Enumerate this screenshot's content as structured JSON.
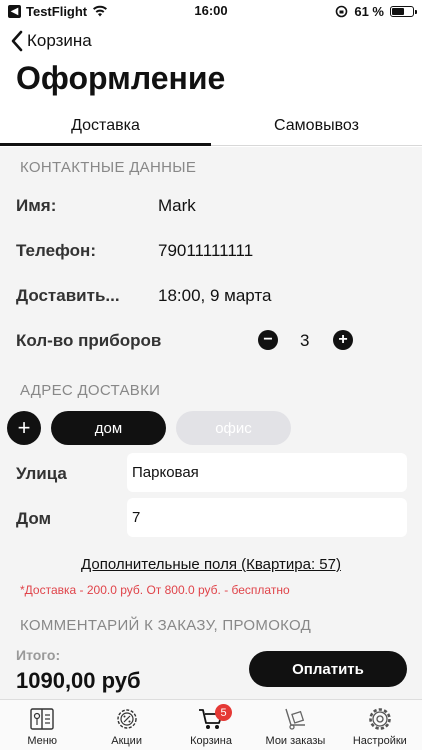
{
  "status_bar": {
    "carrier": "TestFlight",
    "time": "16:00",
    "battery": "61 %",
    "battery_level": 0.61
  },
  "nav": {
    "back_label": "Корзина",
    "title": "Оформление"
  },
  "tabs": [
    {
      "label": "Доставка",
      "active": true
    },
    {
      "label": "Самовывоз",
      "active": false
    }
  ],
  "contact": {
    "header": "КОНТАКТНЫЕ ДАННЫЕ",
    "name_label": "Имя:",
    "name_value": "Mark",
    "phone_label": "Телефон:",
    "phone_value": "79011111111",
    "delivery_label": "Доставить...",
    "delivery_value": "18:00, 9 марта",
    "cutlery_label": "Кол-во приборов",
    "cutlery_minus": "−",
    "cutlery_count": "3",
    "cutlery_plus": "+"
  },
  "address": {
    "header": "АДРЕС ДОСТАВКИ",
    "add": "+",
    "chips": [
      "дом",
      "офис"
    ],
    "street_label": "Улица",
    "street_value": "Парковая",
    "house_label": "Дом",
    "house_value": "7",
    "extra_fields": "Дополнительные поля (Квартира: 57)",
    "note": "*Доставка - 200.0 руб. От 800.0 руб. - бесплатно"
  },
  "comment": {
    "header": "КОММЕНТАРИЙ К ЗАКАЗУ, ПРОМОКОД"
  },
  "footer": {
    "total_label": "Итого:",
    "total_value": "1090,00 руб",
    "pay_label": "Оплатить"
  },
  "tabbar": [
    {
      "label": "Меню",
      "icon": "menu-book-icon"
    },
    {
      "label": "Акции",
      "icon": "discount-gear-icon"
    },
    {
      "label": "Корзина",
      "icon": "cart-icon",
      "badge": "5"
    },
    {
      "label": "Мои заказы",
      "icon": "hand-truck-icon"
    },
    {
      "label": "Настройки",
      "icon": "settings-gear-icon"
    }
  ],
  "colors": {
    "accent": "#111111",
    "note_red": "#e0444a",
    "badge_red": "#e53935",
    "background_gray": "#f4f4f4"
  }
}
